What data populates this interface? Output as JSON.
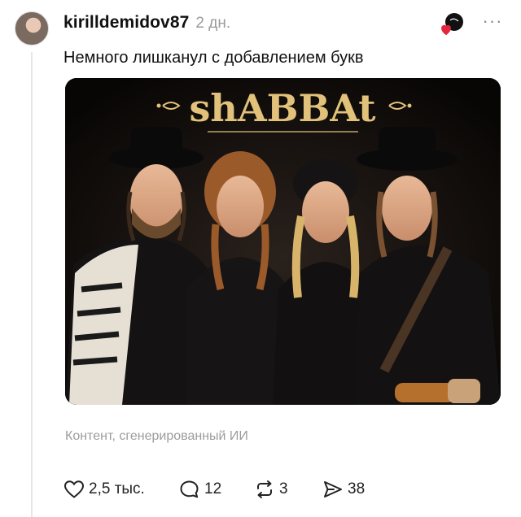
{
  "post": {
    "username": "kirilldemidov87",
    "time_ago": "2 дн.",
    "text": "Немного лишканул с добавлением букв",
    "more_label": "···",
    "image": {
      "title_text": "shABBAt"
    },
    "ai_note": "Контент, сгенерированный ИИ"
  },
  "actions": {
    "likes": "2,5 тыс.",
    "replies": "12",
    "reposts": "3",
    "shares": "38"
  },
  "icons": {
    "like": "heart-icon",
    "reply": "comment-bubble-icon",
    "repost": "repost-arrows-icon",
    "share": "send-arrow-icon",
    "more": "more-dots-icon",
    "badge": "heart-badge-icon"
  },
  "colors": {
    "title_gold": "#e2c27a",
    "badge_red": "#e3263b",
    "muted_text": "#9a9a9a"
  }
}
